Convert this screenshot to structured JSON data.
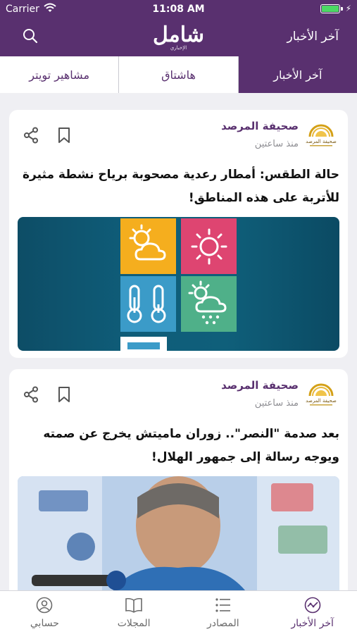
{
  "status_bar": {
    "carrier": "Carrier",
    "time": "11:08 AM"
  },
  "header": {
    "title": "آخر الأخبار",
    "logo_text": "شامل",
    "logo_subtitle": "الإخباري"
  },
  "tabs": [
    {
      "label": "آخر الأخبار",
      "active": true
    },
    {
      "label": "هاشتاق",
      "active": false
    },
    {
      "label": "مشاهير تويتر",
      "active": false
    }
  ],
  "articles": [
    {
      "source": "صحيفة المرصد",
      "time": "منذ ساعتين",
      "headline": "حالة الطقس: أمطار رعدية مصحوبة برياح نشطة مثيرة للأتربة على هذه المناطق!",
      "image": "weather-icons"
    },
    {
      "source": "صحيفة المرصد",
      "time": "منذ ساعتين",
      "headline": "بعد صدمة \"النصر\".. زوران ماميتش يخرج عن صمته ويوجه رسالة إلى جمهور الهلال!",
      "image": "press-conference-photo"
    }
  ],
  "source_logo_text": "صحيفة المرصد",
  "tab_bar": [
    {
      "label": "حسابي",
      "icon": "profile-icon",
      "active": false
    },
    {
      "label": "المجلات",
      "icon": "book-icon",
      "active": false
    },
    {
      "label": "المصادر",
      "icon": "list-icon",
      "active": false
    },
    {
      "label": "آخر الأخبار",
      "icon": "news-icon",
      "active": true
    }
  ],
  "colors": {
    "brand": "#59306f",
    "background": "#efeff3",
    "battery": "#4cd964"
  }
}
